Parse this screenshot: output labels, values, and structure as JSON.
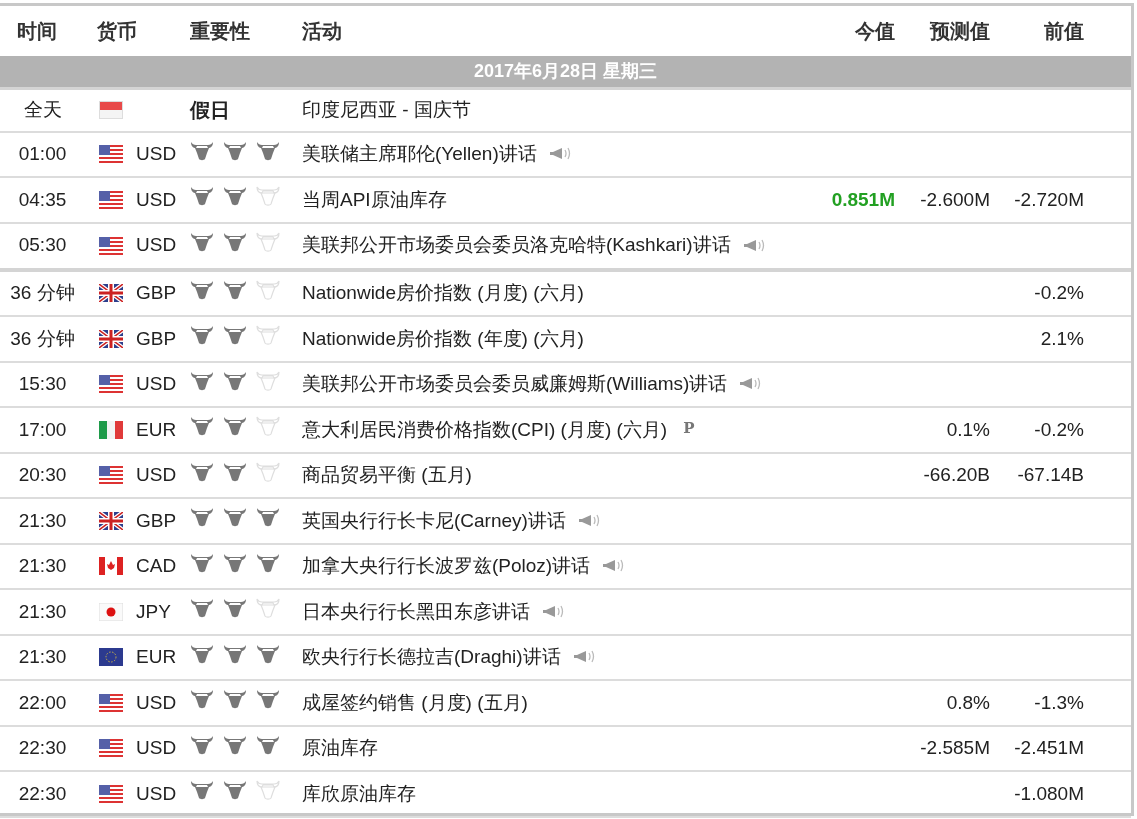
{
  "columns": [
    "时间",
    "货币",
    "重要性",
    "活动",
    "今值",
    "预测值",
    "前值"
  ],
  "date_bar": "2017年6月28日  星期三",
  "rows": [
    {
      "kind": "holiday",
      "time": "全天",
      "flag": {
        "kind": "id"
      },
      "importance_label": "假日",
      "event": "印度尼西亚 - 国庆节"
    },
    {
      "kind": "event",
      "time": "01:00",
      "flag": {
        "kind": "us"
      },
      "currency": "USD",
      "stars": 3,
      "event": "美联储主席耶伦(Yellen)讲话",
      "speech": true
    },
    {
      "kind": "event",
      "time": "04:35",
      "flag": {
        "kind": "us"
      },
      "currency": "USD",
      "stars": 2,
      "event": "当周API原油库存",
      "actual": "0.851M",
      "color": "#22a022",
      "forecast": "-2.600M",
      "previous": "-2.720M"
    },
    {
      "kind": "event",
      "time": "05:30",
      "flag": {
        "kind": "us"
      },
      "currency": "USD",
      "stars": 2,
      "event": "美联邦公开市场委员会委员洛克哈特(Kashkari)讲话",
      "speech": true,
      "thick_divider": true
    },
    {
      "kind": "event",
      "time": "36 分钟",
      "flag": {
        "kind": "gb"
      },
      "currency": "GBP",
      "stars": 2,
      "event": "Nationwide房价指数 (月度) (六月)",
      "previous": "-0.2%"
    },
    {
      "kind": "event",
      "time": "36 分钟",
      "flag": {
        "kind": "gb"
      },
      "currency": "GBP",
      "stars": 2,
      "event": "Nationwide房价指数 (年度) (六月)",
      "previous": "2.1%"
    },
    {
      "kind": "event",
      "time": "15:30",
      "flag": {
        "kind": "us"
      },
      "currency": "USD",
      "stars": 2,
      "event": "美联邦公开市场委员会委员威廉姆斯(Williams)讲话",
      "speech": true
    },
    {
      "kind": "event",
      "time": "17:00",
      "flag": {
        "kind": "it"
      },
      "currency": "EUR",
      "stars": 2,
      "event": "意大利居民消费价格指数(CPI) (月度) (六月)",
      "mark": "P",
      "forecast": "0.1%",
      "previous": "-0.2%"
    },
    {
      "kind": "event",
      "time": "20:30",
      "flag": {
        "kind": "us"
      },
      "currency": "USD",
      "stars": 2,
      "event": "商品贸易平衡 (五月)",
      "forecast": "-66.20B",
      "previous": "-67.14B"
    },
    {
      "kind": "event",
      "time": "21:30",
      "flag": {
        "kind": "gb"
      },
      "currency": "GBP",
      "stars": 3,
      "event": "英国央行行长卡尼(Carney)讲话",
      "speech": true
    },
    {
      "kind": "event",
      "time": "21:30",
      "flag": {
        "kind": "ca"
      },
      "currency": "CAD",
      "stars": 3,
      "event": "加拿大央行行长波罗兹(Poloz)讲话",
      "speech": true
    },
    {
      "kind": "event",
      "time": "21:30",
      "flag": {
        "kind": "jp"
      },
      "currency": "JPY",
      "stars": 2,
      "event": "日本央行行长黑田东彦讲话",
      "speech": true
    },
    {
      "kind": "event",
      "time": "21:30",
      "flag": {
        "kind": "eu"
      },
      "currency": "EUR",
      "stars": 3,
      "event": "欧央行行长德拉吉(Draghi)讲话",
      "speech": true
    },
    {
      "kind": "event",
      "time": "22:00",
      "flag": {
        "kind": "us"
      },
      "currency": "USD",
      "stars": 3,
      "event": "成屋签约销售 (月度) (五月)",
      "forecast": "0.8%",
      "previous": "-1.3%"
    },
    {
      "kind": "event",
      "time": "22:30",
      "flag": {
        "kind": "us"
      },
      "currency": "USD",
      "stars": 3,
      "event": "原油库存",
      "forecast": "-2.585M",
      "previous": "-2.451M"
    },
    {
      "kind": "event",
      "time": "22:30",
      "flag": {
        "kind": "us"
      },
      "currency": "USD",
      "stars": 2,
      "event": "库欣原油库存",
      "previous": "-1.080M"
    }
  ]
}
